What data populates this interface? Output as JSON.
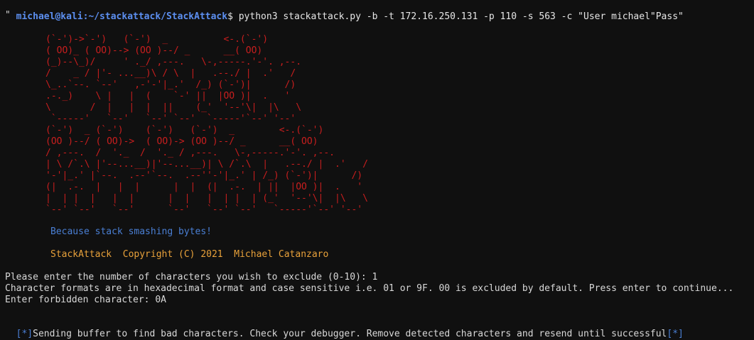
{
  "terminal": {
    "prompt_user": "michael@kali",
    "prompt_path": ":~/stackattack/StackAttack",
    "prompt_symbol": "$",
    "command": " python3 stackattack.py -b -t 172.16.250.131 -p 110 -s 563 -c \"User michael\"Pass\"",
    "continuation": "\""
  },
  "banner": {
    "art": "(`-')->`-')   (`-')  _          <-.(`-')\n( OO)_ ( OO)--> (OO )--/ _      __( OO)\n(_)--\\_)/     ' ._/ ,---.   \\-,-----.'-'. ,--.\n/    _ / |'- ...__)\\ / \\  |   .--./ |  .'   /\n\\_..`--. `--'   ,-'-'|_.'  /_) (`-')|      /)\n.-._)    \\ |   |  (    `-' ||  |OO )|  .   '\n\\       /  |   |  |  ||    (_'  '--'\\|  |\\   \\\n `-----'   `--'   `--' `--'  `-----'`--' '--'\n(`-')  _ (`-')    (`-')   (`-')  _        <-.(`-')\n(OO )--/ ( OO)->  ( OO)-> (OO )--/ _      __( OO)\n/ ,---.  /  '._  /  '._ / ,---.   \\-,-----.'-'. ,--.\n| \\ /`.\\ |'--...__)|'--...__)| \\ /`.\\  |   .--./ |  .'   /\n'-'|_.' |`--.  .--'`--.  .--''-'|_.' | /_) (`-')|      /)\n(|  .-.  |   |  |      |  |  (|  .-.  | ||  |OO )|  .   '\n|  | |  |   |  |      |  |   |  | |  | (_'  '--'\\|  |\\   \\\n`--' `--'   `--'      `--'   `--' `--'   `-----'`--' '--'",
    "tagline": "Because stack smashing bytes!",
    "copyright": "StackAttack  Copyright (C) 2021  Michael Catanzaro"
  },
  "output": {
    "exclude_prompt": "Please enter the number of characters you wish to exclude (0-10): 1",
    "format_info": "Character formats are in hexadecimal format and case sensitive i.e. 01 or 9F. 00 is excluded by default. Press enter to continue...",
    "forbidden_prompt": "Enter forbidden character: 0A",
    "status_open": "[*]",
    "status_text": "Sending buffer to find bad characters. Check your debugger. Remove detected characters and resend until successful",
    "status_close": "[*]"
  },
  "colors": {
    "background": "#101010",
    "prompt": "#5c8ff0",
    "art": "#c81e1e",
    "tagline": "#4a7fd4",
    "copyright": "#e8a13a",
    "text": "#d8d8d8"
  }
}
